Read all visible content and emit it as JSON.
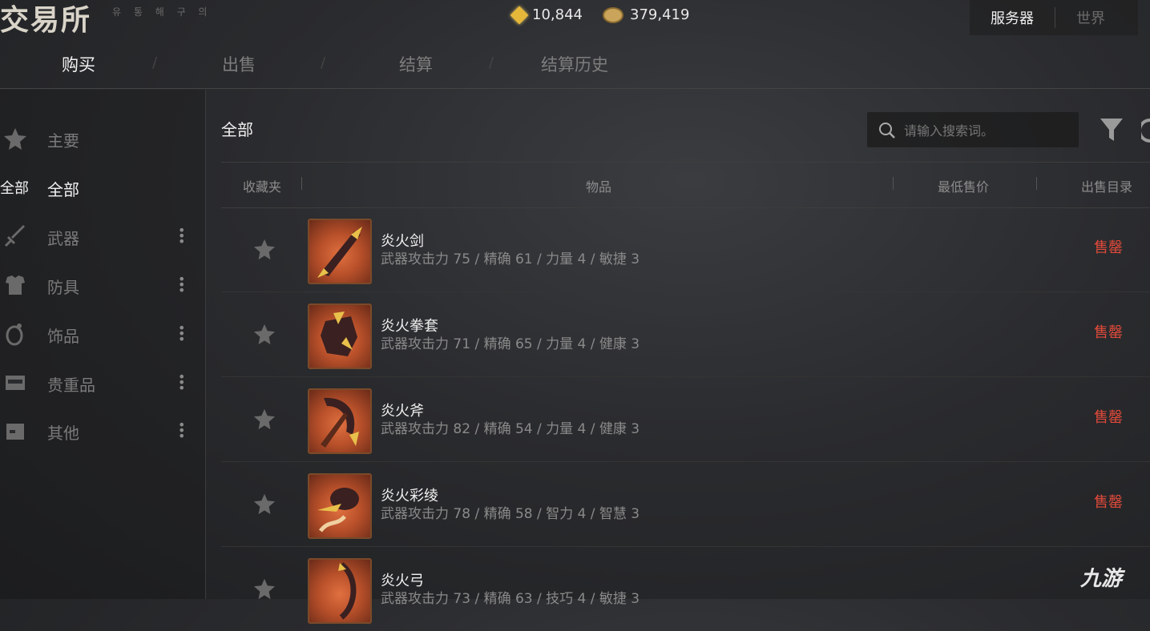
{
  "app": {
    "title": "交易所",
    "subtitle": "유 통 해 구 의"
  },
  "currency": [
    {
      "icon": "gem-icon",
      "value": "10,844"
    },
    {
      "icon": "coin-icon",
      "value": "379,419"
    }
  ],
  "server_toggle": {
    "server": "服务器",
    "world": "世界"
  },
  "tabs": [
    {
      "label": "购买"
    },
    {
      "label": "出售"
    },
    {
      "label": "结算"
    },
    {
      "label": "结算历史"
    }
  ],
  "sidebar": {
    "items": [
      {
        "label": "主要",
        "icon": "star-icon"
      },
      {
        "label": "全部",
        "icon_text": "全部"
      },
      {
        "label": "武器",
        "icon": "sword-icon"
      },
      {
        "label": "防具",
        "icon": "armor-icon"
      },
      {
        "label": "饰品",
        "icon": "ring-icon"
      },
      {
        "label": "贵重品",
        "icon": "chest-icon"
      },
      {
        "label": "其他",
        "icon": "box-icon"
      }
    ]
  },
  "main": {
    "title": "全部",
    "search_placeholder": "请输入搜索词。",
    "columns": {
      "favorite": "收藏夹",
      "item": "物品",
      "min_price": "最低售价",
      "listing": "出售目录"
    },
    "items": [
      {
        "name": "炎火剑",
        "stats": "武器攻击力 75 / 精确 61 / 力量 4 / 敏捷 3",
        "status": "售罄"
      },
      {
        "name": "炎火拳套",
        "stats": "武器攻击力 71 / 精确 65 / 力量 4 / 健康 3",
        "status": "售罄"
      },
      {
        "name": "炎火斧",
        "stats": "武器攻击力 82 / 精确 54 / 力量 4 / 健康 3",
        "status": "售罄"
      },
      {
        "name": "炎火彩绫",
        "stats": "武器攻击力 78 / 精确 58 / 智力 4 / 智慧 3",
        "status": "售罄"
      },
      {
        "name": "炎火弓",
        "stats": "武器攻击力 73 / 精确 63 / 技巧 4 / 敏捷 3",
        "status": ""
      }
    ]
  },
  "watermark": "九游",
  "colors": {
    "sold_out": "#e04a3a",
    "accent_gold": "#e6b83a"
  }
}
